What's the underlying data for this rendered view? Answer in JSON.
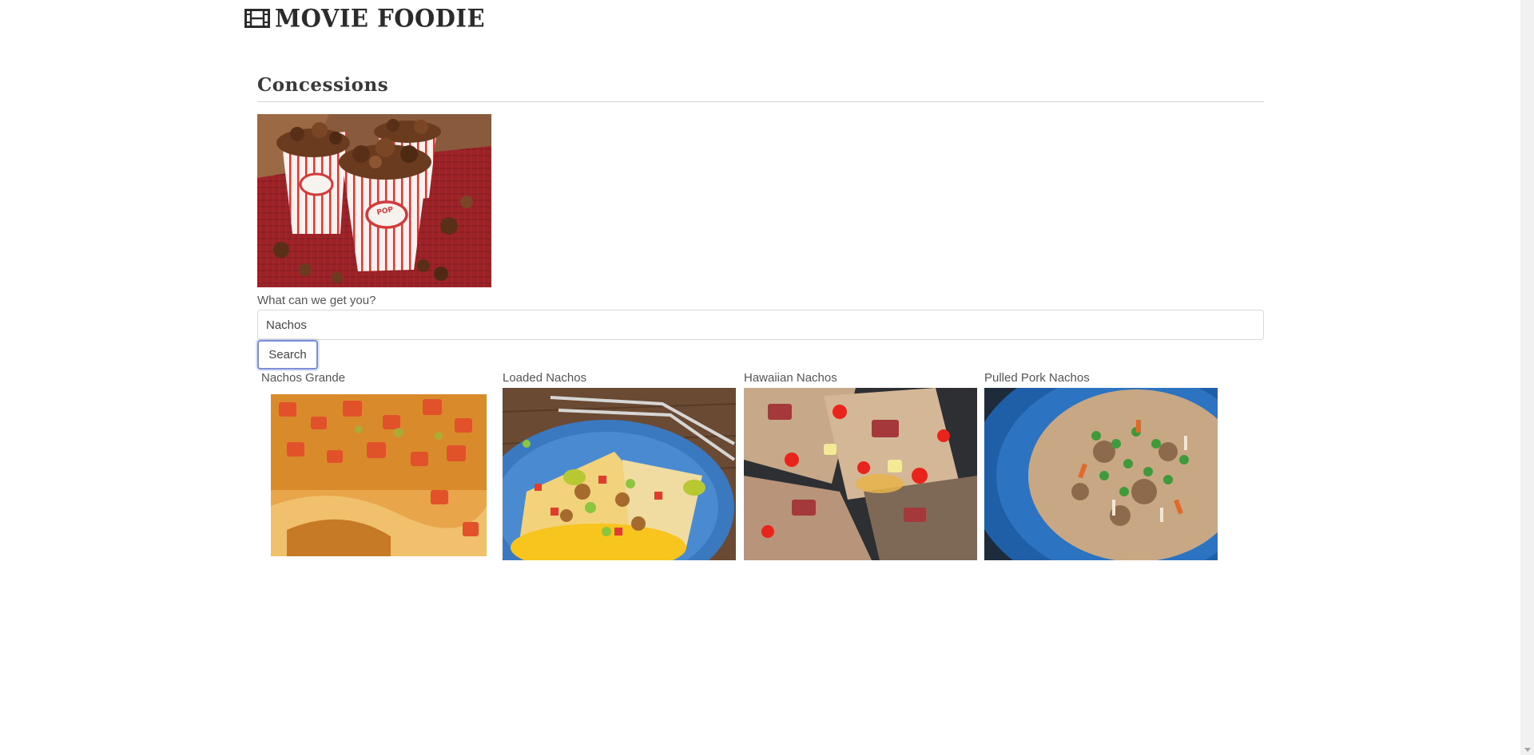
{
  "brand": {
    "title": "MOVIE FOODIE",
    "icon": "film-icon"
  },
  "section": {
    "heading": "Concessions"
  },
  "hero": {
    "icon": "popcorn-image",
    "caption_text": "POP CORN"
  },
  "search": {
    "label": "What can we get you?",
    "value": "Nachos",
    "button_label": "Search"
  },
  "results": [
    {
      "title": "Nachos Grande"
    },
    {
      "title": "Loaded Nachos"
    },
    {
      "title": "Hawaiian Nachos"
    },
    {
      "title": "Pulled Pork Nachos"
    }
  ],
  "colors": {
    "focus_border": "#7d8fd6",
    "rule": "#d4d4d4",
    "text": "#444444"
  }
}
